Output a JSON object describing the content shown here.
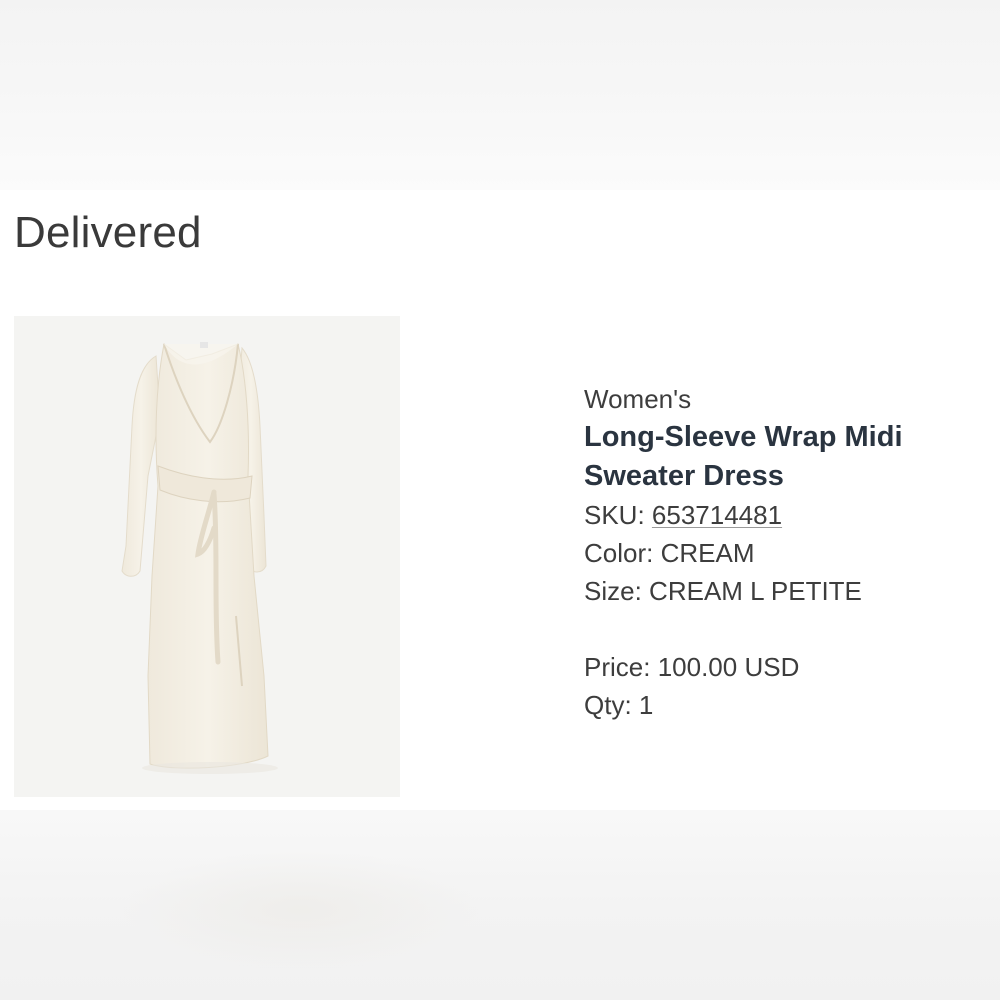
{
  "order": {
    "status": "Delivered"
  },
  "product": {
    "category": "Women's",
    "name_line1": "Long-Sleeve Wrap Midi",
    "name_line2": "Sweater Dress",
    "sku_label": "SKU:",
    "sku_value": "653714481",
    "color_label": "Color:",
    "color_value": "CREAM",
    "size_label": "Size:",
    "size_value": "CREAM L PETITE",
    "price_label": "Price:",
    "price_value": "100.00 USD",
    "qty_label": "Qty:",
    "qty_value": "1",
    "image_icon": "wrap-midi-dress-photo"
  },
  "colors": {
    "heading": "#3a3a3a",
    "product_name": "#2a3440",
    "body_text": "#3d3d3d",
    "dress": "#f3eee2",
    "image_bg": "#f4f4f2"
  }
}
